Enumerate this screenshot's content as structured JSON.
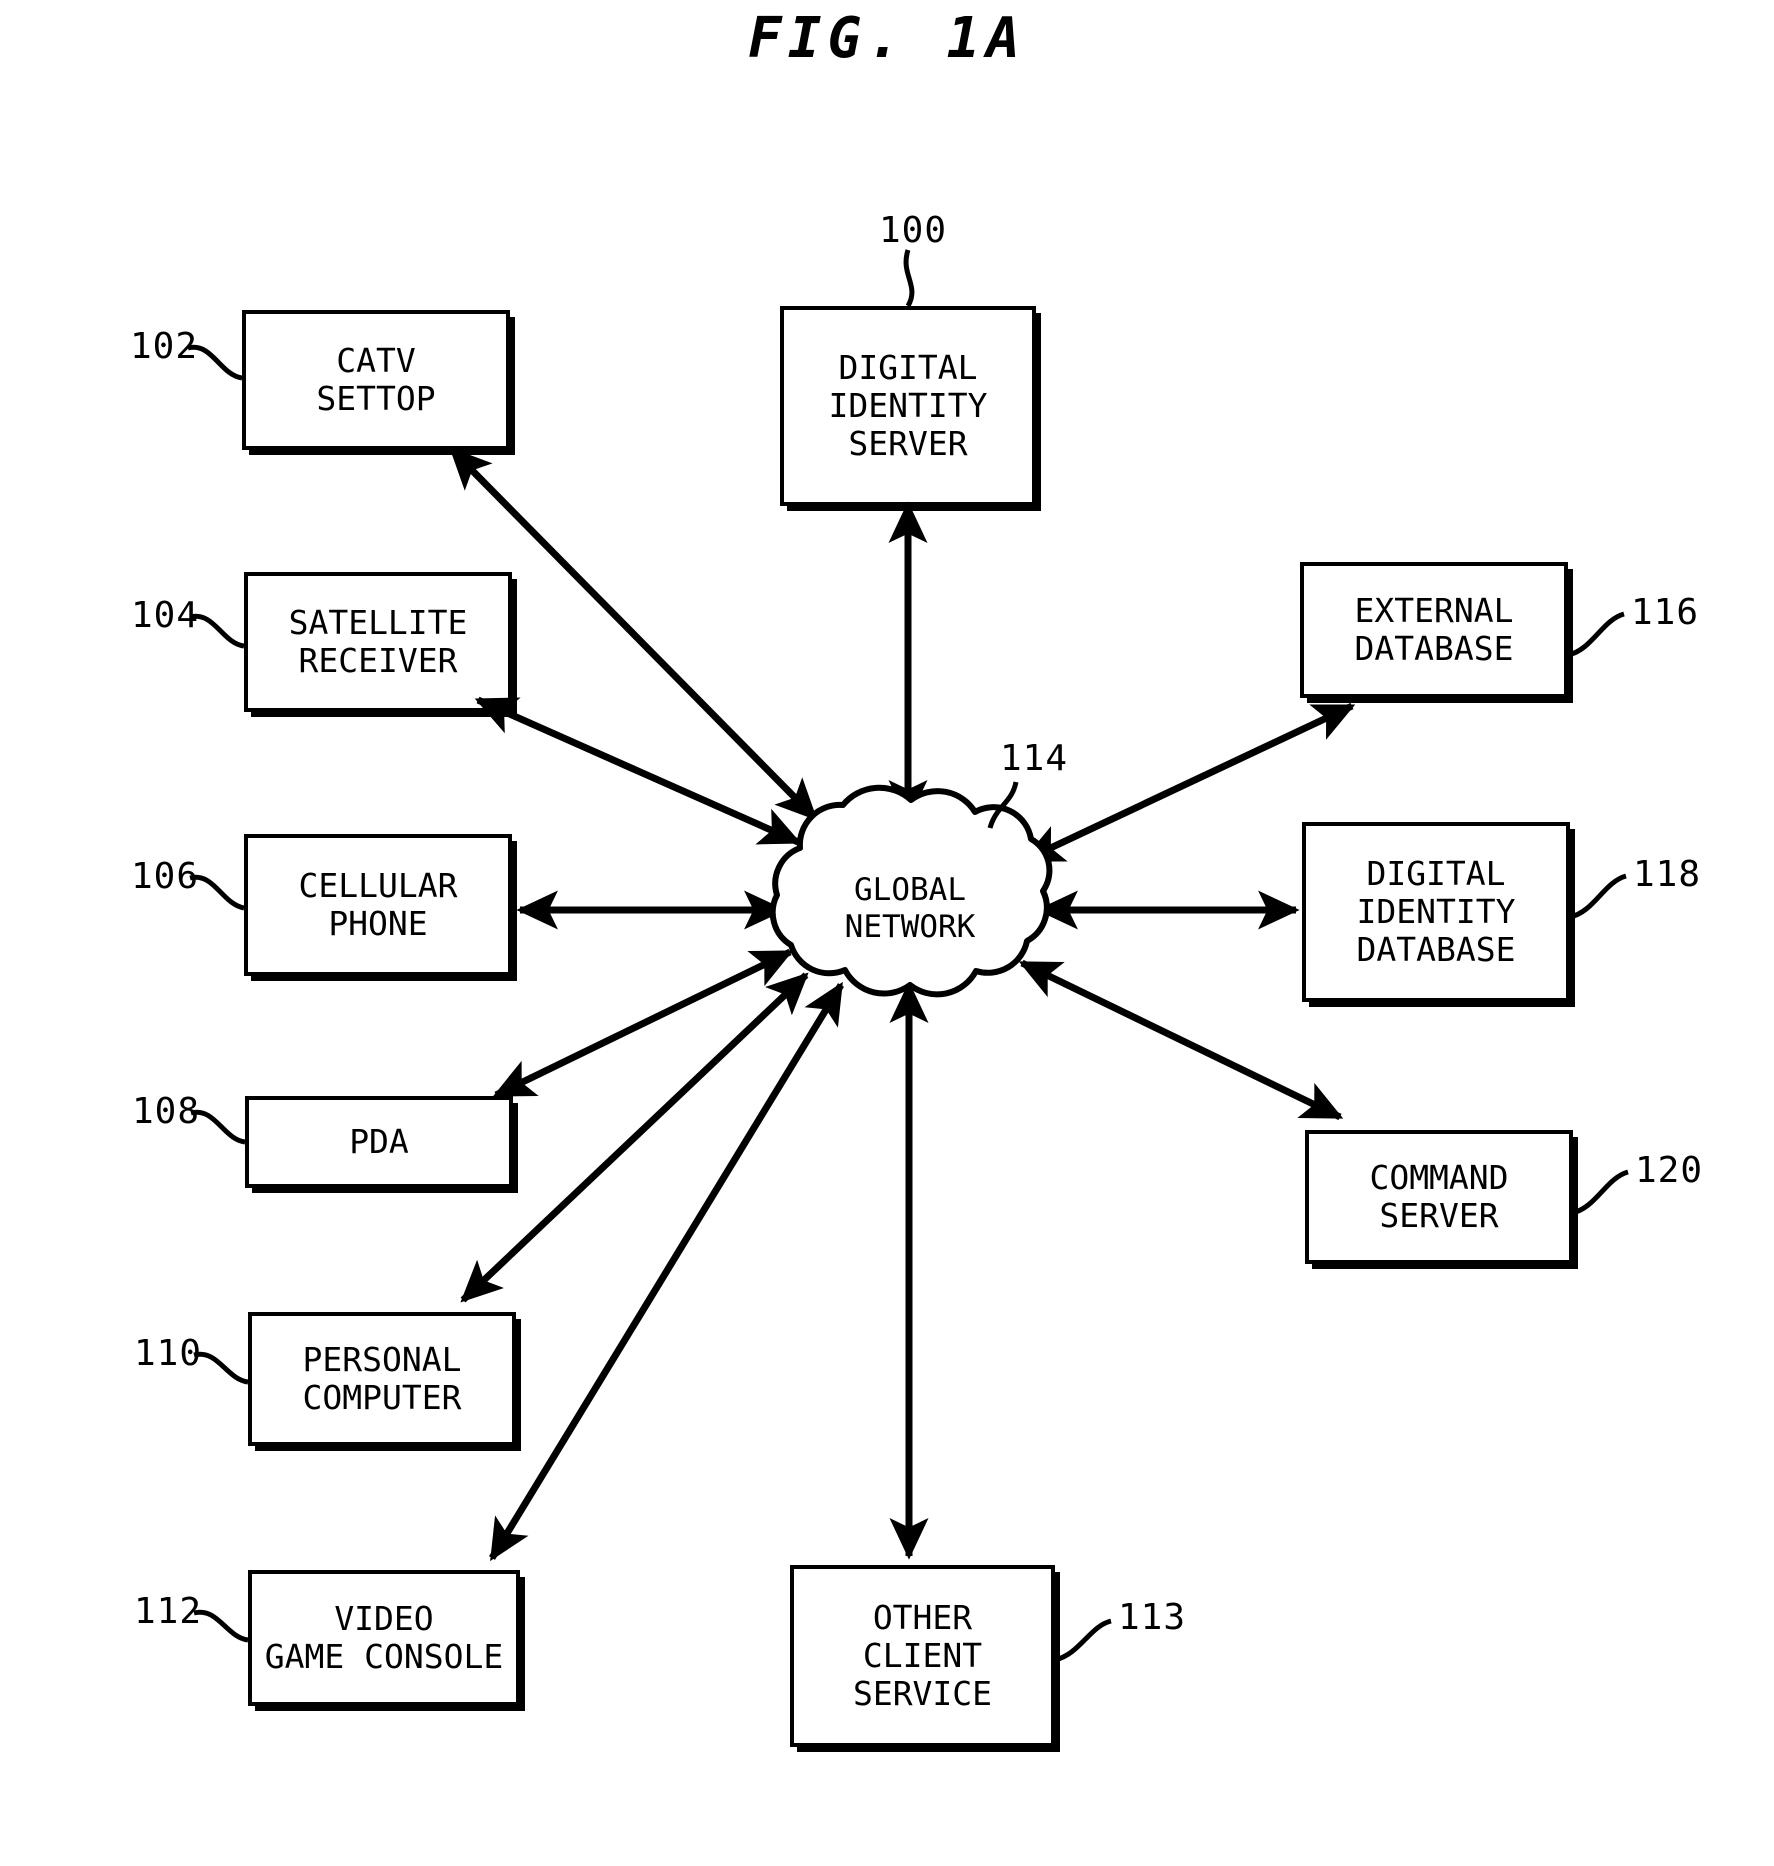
{
  "figure": {
    "title": "FIG. 1A"
  },
  "nodes": {
    "digital_identity_server": {
      "label": "DIGITAL\nIDENTITY\nSERVER",
      "ref": "100"
    },
    "catv_settop": {
      "label": "CATV\nSETTOP",
      "ref": "102"
    },
    "satellite_receiver": {
      "label": "SATELLITE\nRECEIVER",
      "ref": "104"
    },
    "cellular_phone": {
      "label": "CELLULAR\nPHONE",
      "ref": "106"
    },
    "pda": {
      "label": "PDA",
      "ref": "108"
    },
    "personal_computer": {
      "label": "PERSONAL\nCOMPUTER",
      "ref": "110"
    },
    "video_game_console": {
      "label": "VIDEO\nGAME CONSOLE",
      "ref": "112"
    },
    "other_client_service": {
      "label": "OTHER\nCLIENT\nSERVICE",
      "ref": "113"
    },
    "global_network": {
      "label": "GLOBAL\nNETWORK",
      "ref": "114"
    },
    "external_database": {
      "label": "EXTERNAL\nDATABASE",
      "ref": "116"
    },
    "digital_identity_database": {
      "label": "DIGITAL\nIDENTITY\nDATABASE",
      "ref": "118"
    },
    "command_server": {
      "label": "COMMAND\nSERVER",
      "ref": "120"
    }
  },
  "connections": [
    {
      "from": "global_network",
      "to": "digital_identity_server",
      "arrows": "both"
    },
    {
      "from": "global_network",
      "to": "catv_settop",
      "arrows": "both"
    },
    {
      "from": "global_network",
      "to": "satellite_receiver",
      "arrows": "both"
    },
    {
      "from": "global_network",
      "to": "cellular_phone",
      "arrows": "both"
    },
    {
      "from": "global_network",
      "to": "pda",
      "arrows": "both"
    },
    {
      "from": "global_network",
      "to": "personal_computer",
      "arrows": "both"
    },
    {
      "from": "global_network",
      "to": "video_game_console",
      "arrows": "both"
    },
    {
      "from": "global_network",
      "to": "other_client_service",
      "arrows": "both"
    },
    {
      "from": "global_network",
      "to": "external_database",
      "arrows": "both"
    },
    {
      "from": "global_network",
      "to": "digital_identity_database",
      "arrows": "both"
    },
    {
      "from": "global_network",
      "to": "command_server",
      "arrows": "both"
    }
  ],
  "colors": {
    "line": "#000000",
    "background": "#ffffff"
  }
}
